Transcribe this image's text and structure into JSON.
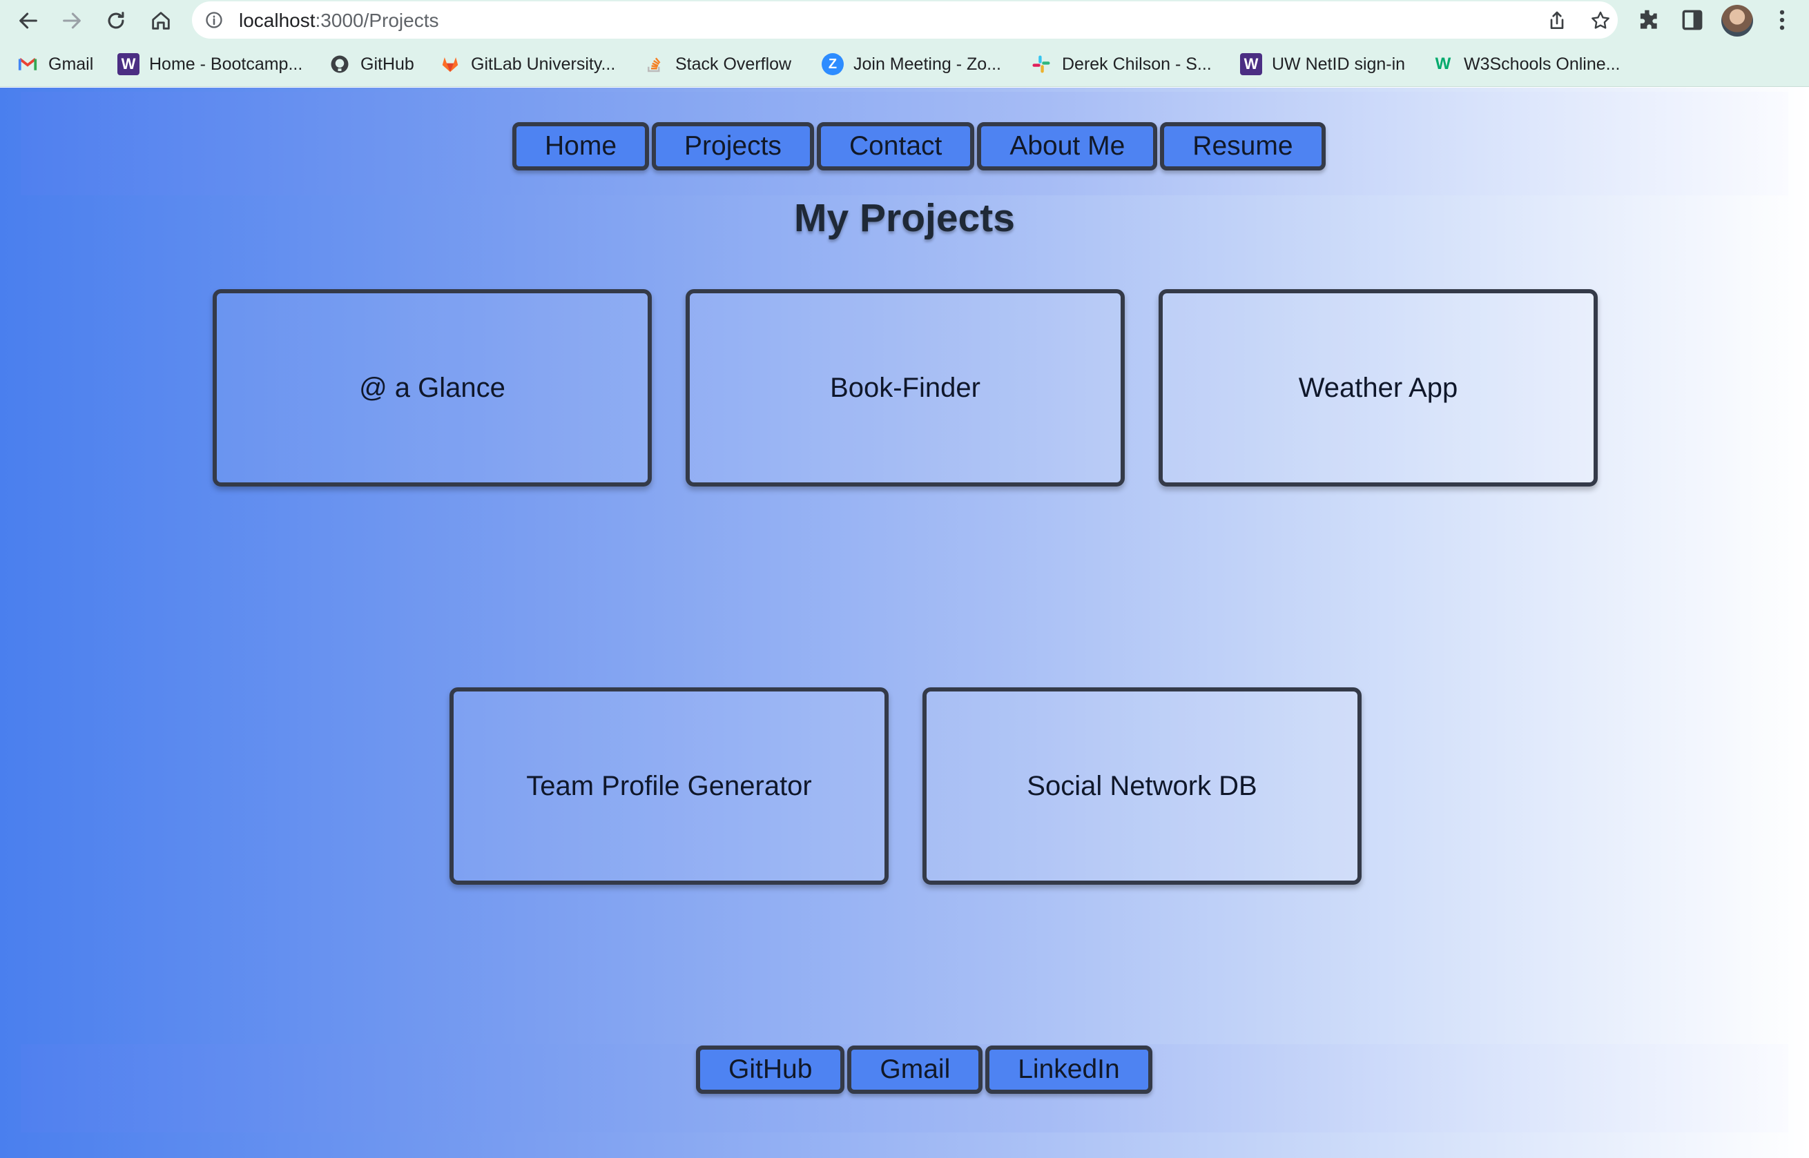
{
  "browser": {
    "url_host": "localhost",
    "url_path": ":3000/Projects",
    "icons": [
      "back-icon",
      "forward-icon",
      "reload-icon",
      "home-icon",
      "info-icon",
      "share-icon",
      "star-icon",
      "extensions-icon",
      "sidepanel-icon",
      "avatar",
      "menu-icon"
    ],
    "bookmarks": [
      {
        "label": "Gmail",
        "icon": "gmail-icon"
      },
      {
        "label": "Home - Bootcamp...",
        "icon": "uw-icon"
      },
      {
        "label": "GitHub",
        "icon": "github-icon"
      },
      {
        "label": "GitLab University...",
        "icon": "gitlab-icon"
      },
      {
        "label": "Stack Overflow",
        "icon": "stackoverflow-icon"
      },
      {
        "label": "Join Meeting - Zo...",
        "icon": "zoom-icon"
      },
      {
        "label": "Derek Chilson - S...",
        "icon": "slack-icon"
      },
      {
        "label": "UW NetID sign-in",
        "icon": "uw-icon"
      },
      {
        "label": "W3Schools Online...",
        "icon": "w3schools-icon"
      }
    ],
    "bookmarks_overflow": "»"
  },
  "nav": {
    "links": [
      "Home",
      "Projects",
      "Contact",
      "About Me",
      "Resume"
    ]
  },
  "page": {
    "title": "My Projects",
    "projects": [
      "@ a Glance",
      "Book-Finder",
      "Weather App",
      "Team Profile Generator",
      "Social Network DB"
    ]
  },
  "footer": {
    "links": [
      "GitHub",
      "Gmail",
      "LinkedIn"
    ]
  },
  "colors": {
    "gradient_start": "#4a7fee",
    "gradient_end": "#ffffff",
    "button_fill": "#4e83f2",
    "border": "#343a48",
    "chrome": "#dff2ec"
  }
}
